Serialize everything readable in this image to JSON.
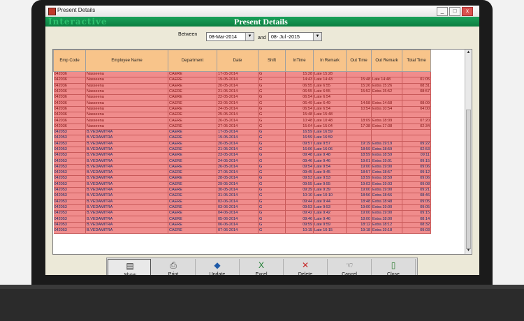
{
  "window": {
    "title": "Present Details",
    "brand": "Interactive",
    "heading": "Present Details",
    "controls": [
      "_",
      "□",
      "x"
    ]
  },
  "filter": {
    "between_label": "Between",
    "and_label": "and",
    "from_date": "08-Mar-2014",
    "to_date": "08- Jul -2015"
  },
  "grid": {
    "headers": [
      "Emp Code",
      "Employee Name",
      "Department",
      "Date",
      "Shift",
      "InTime",
      "In Remark",
      "Out Time",
      "Out Remark",
      "Total Time"
    ],
    "rows": [
      [
        "042036",
        "Nasseena",
        "CAERE",
        "17-05-2014",
        "G",
        "15:28",
        "Late 15:28",
        "",
        "",
        ""
      ],
      [
        "042036",
        "Nasseena",
        "CAERE",
        "19-05-2014",
        "G",
        "14:43",
        "Late 14:43",
        "15:48",
        "Late 14:48",
        "01:05"
      ],
      [
        "042036",
        "Nasseena",
        "CAERE",
        "20-05-2014",
        "G",
        "06:55",
        "Late 6:55",
        "15:26",
        "Extra 15:26",
        "08:31"
      ],
      [
        "042036",
        "Nasseena",
        "CAERE",
        "21-05-2014",
        "G",
        "06:55",
        "Late 6:55",
        "15:52",
        "Extra 15:52",
        "08:57"
      ],
      [
        "042036",
        "Nasseena",
        "CAERE",
        "22-05-2014",
        "G",
        "06:54",
        "Late 6:54",
        "",
        "",
        ""
      ],
      [
        "042036",
        "Nasseena",
        "CAERE",
        "23-05-2014",
        "G",
        "06:49",
        "Late 6:49",
        "14:58",
        "Extra 14:58",
        "08:09"
      ],
      [
        "042036",
        "Nasseena",
        "CAERE",
        "24-05-2014",
        "G",
        "06:54",
        "Late 6:54",
        "10:54",
        "Extra 10:54",
        "04:00"
      ],
      [
        "042036",
        "Nasseena",
        "CAERE",
        "25-05-2014",
        "G",
        "15:48",
        "Late 15:48",
        "",
        "",
        ""
      ],
      [
        "042036",
        "Nasseena",
        "CAERE",
        "26-05-2014",
        "G",
        "10:48",
        "Late 10:48",
        "18:09",
        "Extra 18:09",
        "07:20"
      ],
      [
        "042036",
        "Nasseena",
        "CAERE",
        "27-05-2014",
        "G",
        "15:04",
        "Late 15:04",
        "17:38",
        "Extra 17:38",
        "02:34"
      ],
      [
        "042053",
        "B.VEDAMITRA",
        "CAERE",
        "17-05-2014",
        "G",
        "16:59",
        "Late 16:59",
        "",
        "",
        ""
      ],
      [
        "042053",
        "B.VEDAMITRA",
        "CAERE",
        "19-05-2014",
        "G",
        "16:59",
        "Late 16:59",
        "",
        "",
        ""
      ],
      [
        "042053",
        "B.VEDAMITRA",
        "CAERE",
        "20-05-2014",
        "G",
        "09:57",
        "Late 9:57",
        "19:19",
        "Extra 19:19",
        "09:22"
      ],
      [
        "042053",
        "B.VEDAMITRA",
        "CAERE",
        "21-05-2014",
        "G",
        "16:06",
        "Late 16:06",
        "18:59",
        "Extra 18:59",
        "02:53"
      ],
      [
        "042053",
        "B.VEDAMITRA",
        "CAERE",
        "23-05-2014",
        "G",
        "09:48",
        "Late 9:48",
        "18:59",
        "Extra 18:59",
        "09:11"
      ],
      [
        "042053",
        "B.VEDAMITRA",
        "CAERE",
        "24-05-2014",
        "G",
        "09:46",
        "Late 9:46",
        "19:01",
        "Extra 19:01",
        "09:15"
      ],
      [
        "042053",
        "B.VEDAMITRA",
        "CAERE",
        "26-05-2014",
        "G",
        "09:54",
        "Late 9:54",
        "19:00",
        "Extra 19:00",
        "09:06"
      ],
      [
        "042053",
        "B.VEDAMITRA",
        "CAERE",
        "27-05-2014",
        "G",
        "09:45",
        "Late 9:45",
        "18:57",
        "Extra 18:57",
        "09:12"
      ],
      [
        "042053",
        "B.VEDAMITRA",
        "CAERE",
        "28-05-2014",
        "G",
        "09:53",
        "Late 9:53",
        "18:59",
        "Extra 18:59",
        "09:06"
      ],
      [
        "042053",
        "B.VEDAMITRA",
        "CAERE",
        "29-05-2014",
        "G",
        "09:55",
        "Late 9:55",
        "19:03",
        "Extra 19:03",
        "09:08"
      ],
      [
        "042053",
        "B.VEDAMITRA",
        "CAERE",
        "30-05-2014",
        "G",
        "09:39",
        "Late 9:39",
        "19:00",
        "Extra 19:00",
        "09:21"
      ],
      [
        "042053",
        "B.VEDAMITRA",
        "CAERE",
        "31-05-2014",
        "G",
        "10:10",
        "Late 10:10",
        "18:56",
        "Extra 18:56",
        "08:46"
      ],
      [
        "042053",
        "B.VEDAMITRA",
        "CAERE",
        "02-06-2014",
        "G",
        "09:44",
        "Late 9:44",
        "18:48",
        "Extra 18:48",
        "09:05"
      ],
      [
        "042053",
        "B.VEDAMITRA",
        "CAERE",
        "03-06-2014",
        "G",
        "09:53",
        "Late 9:53",
        "19:00",
        "Extra 19:00",
        "09:05"
      ],
      [
        "042053",
        "B.VEDAMITRA",
        "CAERE",
        "04-06-2014",
        "G",
        "09:42",
        "Late 9:42",
        "19:00",
        "Extra 19:00",
        "09:15"
      ],
      [
        "042053",
        "B.VEDAMITRA",
        "CAERE",
        "05-06-2014",
        "G",
        "09:46",
        "Late 9:46",
        "18:00",
        "Extra 18:00",
        "08:14"
      ],
      [
        "042053",
        "B.VEDAMITRA",
        "CAERE",
        "06-06-2014",
        "G",
        "09:59",
        "Late 9:59",
        "18:12",
        "Extra 18:12",
        "08:32"
      ],
      [
        "042053",
        "B.VEDAMITRA",
        "CAERE",
        "07-06-2014",
        "G",
        "10:15",
        "Late 10:15",
        "19:18",
        "Extra 19:18",
        "09:03"
      ]
    ]
  },
  "toolbar": {
    "buttons": [
      {
        "label": "Show",
        "icon": "show-icon",
        "glyph": "▤"
      },
      {
        "label": "Print",
        "icon": "printer-icon",
        "glyph": "⎙"
      },
      {
        "label": "Update",
        "icon": "update-icon",
        "glyph": "◆"
      },
      {
        "label": "Excel",
        "icon": "excel-icon",
        "glyph": "X"
      },
      {
        "label": "Delete",
        "icon": "delete-icon",
        "glyph": "✕"
      },
      {
        "label": "Cancel",
        "icon": "cancel-icon",
        "glyph": "☜"
      },
      {
        "label": "Close",
        "icon": "exit-door-icon",
        "glyph": "▯"
      }
    ]
  },
  "colors": {
    "row_bg": "#f08c8c",
    "header_bg": "#f8c48a",
    "banner": "#0b7e3f"
  }
}
